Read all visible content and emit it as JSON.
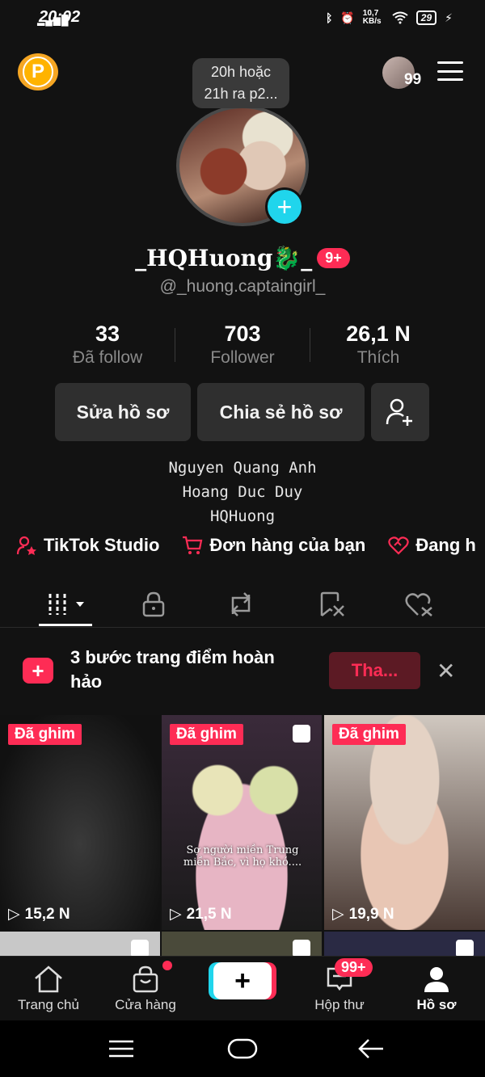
{
  "status_bar": {
    "time": "20:02",
    "network_speed": "10,7 KB/s",
    "battery": "29"
  },
  "header": {
    "points_icon_letter": "P",
    "mini_avatar_count": "99",
    "tooltip": {
      "line1": "20h hoặc",
      "line2": "21h ra p2..."
    }
  },
  "profile": {
    "display_name": "_HQHuong🐉_",
    "notification_badge": "9+",
    "username": "@_huong.captaingirl_"
  },
  "stats": [
    {
      "value": "33",
      "label": "Đã follow"
    },
    {
      "value": "703",
      "label": "Follower"
    },
    {
      "value": "26,1 N",
      "label": "Thích"
    }
  ],
  "actions": {
    "edit": "Sửa hồ sơ",
    "share": "Chia sẻ hồ sơ"
  },
  "bio": [
    "Nguyen Quang Anh",
    "Hoang Duc Duy",
    "HQHuong"
  ],
  "quick_links": [
    {
      "label": "TikTok Studio",
      "icon": "person-star-icon"
    },
    {
      "label": "Đơn hàng của bạn",
      "icon": "cart-icon"
    },
    {
      "label": "Đang h",
      "icon": "heart-handshake-icon"
    }
  ],
  "tabs": [
    "videos-grid-icon",
    "lock-icon",
    "repost-icon",
    "saved-icon",
    "liked-icon"
  ],
  "promo": {
    "text": "3 bước trang điểm hoàn hảo",
    "button": "Tha..."
  },
  "videos": [
    {
      "pinned": "Đã ghim",
      "views": "15,2 N",
      "caption": ""
    },
    {
      "pinned": "Đã ghim",
      "views": "21,5 N",
      "caption": "Sợ người miền Trung miền Bắc, vì họ khó...."
    },
    {
      "pinned": "Đã ghim",
      "views": "19,9 N",
      "caption": ""
    }
  ],
  "bottom_nav": [
    {
      "label": "Trang chủ"
    },
    {
      "label": "Cửa hàng"
    },
    {
      "label": ""
    },
    {
      "label": "Hộp thư",
      "badge": "99+"
    },
    {
      "label": "Hồ sơ"
    }
  ],
  "colors": {
    "accent_red": "#fe2c55",
    "accent_cyan": "#20d5ec",
    "background": "#121212"
  }
}
